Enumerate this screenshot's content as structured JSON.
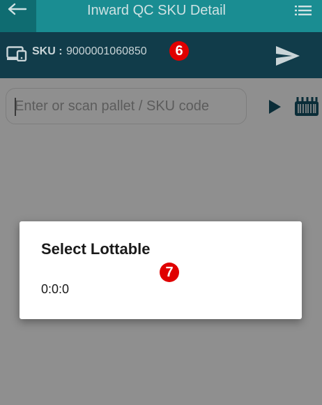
{
  "appbar": {
    "title": "Inward QC SKU Detail",
    "back_icon": "arrow-left-icon",
    "menu_icon": "list-menu-icon",
    "color": "#1a8d92"
  },
  "sku_bar": {
    "label": "SKU :",
    "value": "9000001060850",
    "device_icon": "devices-icon",
    "send_icon": "send-icon",
    "color": "#113c4a"
  },
  "markers": {
    "sku": "6",
    "dialog": "7",
    "color": "#e00000"
  },
  "scan": {
    "placeholder": "Enter or scan pallet / SKU code",
    "value": "",
    "go_icon": "play-icon",
    "scanner_icon": "barcode-scanner-icon"
  },
  "dialog": {
    "title": "Select Lottable",
    "items": [
      "0:0:0"
    ]
  }
}
